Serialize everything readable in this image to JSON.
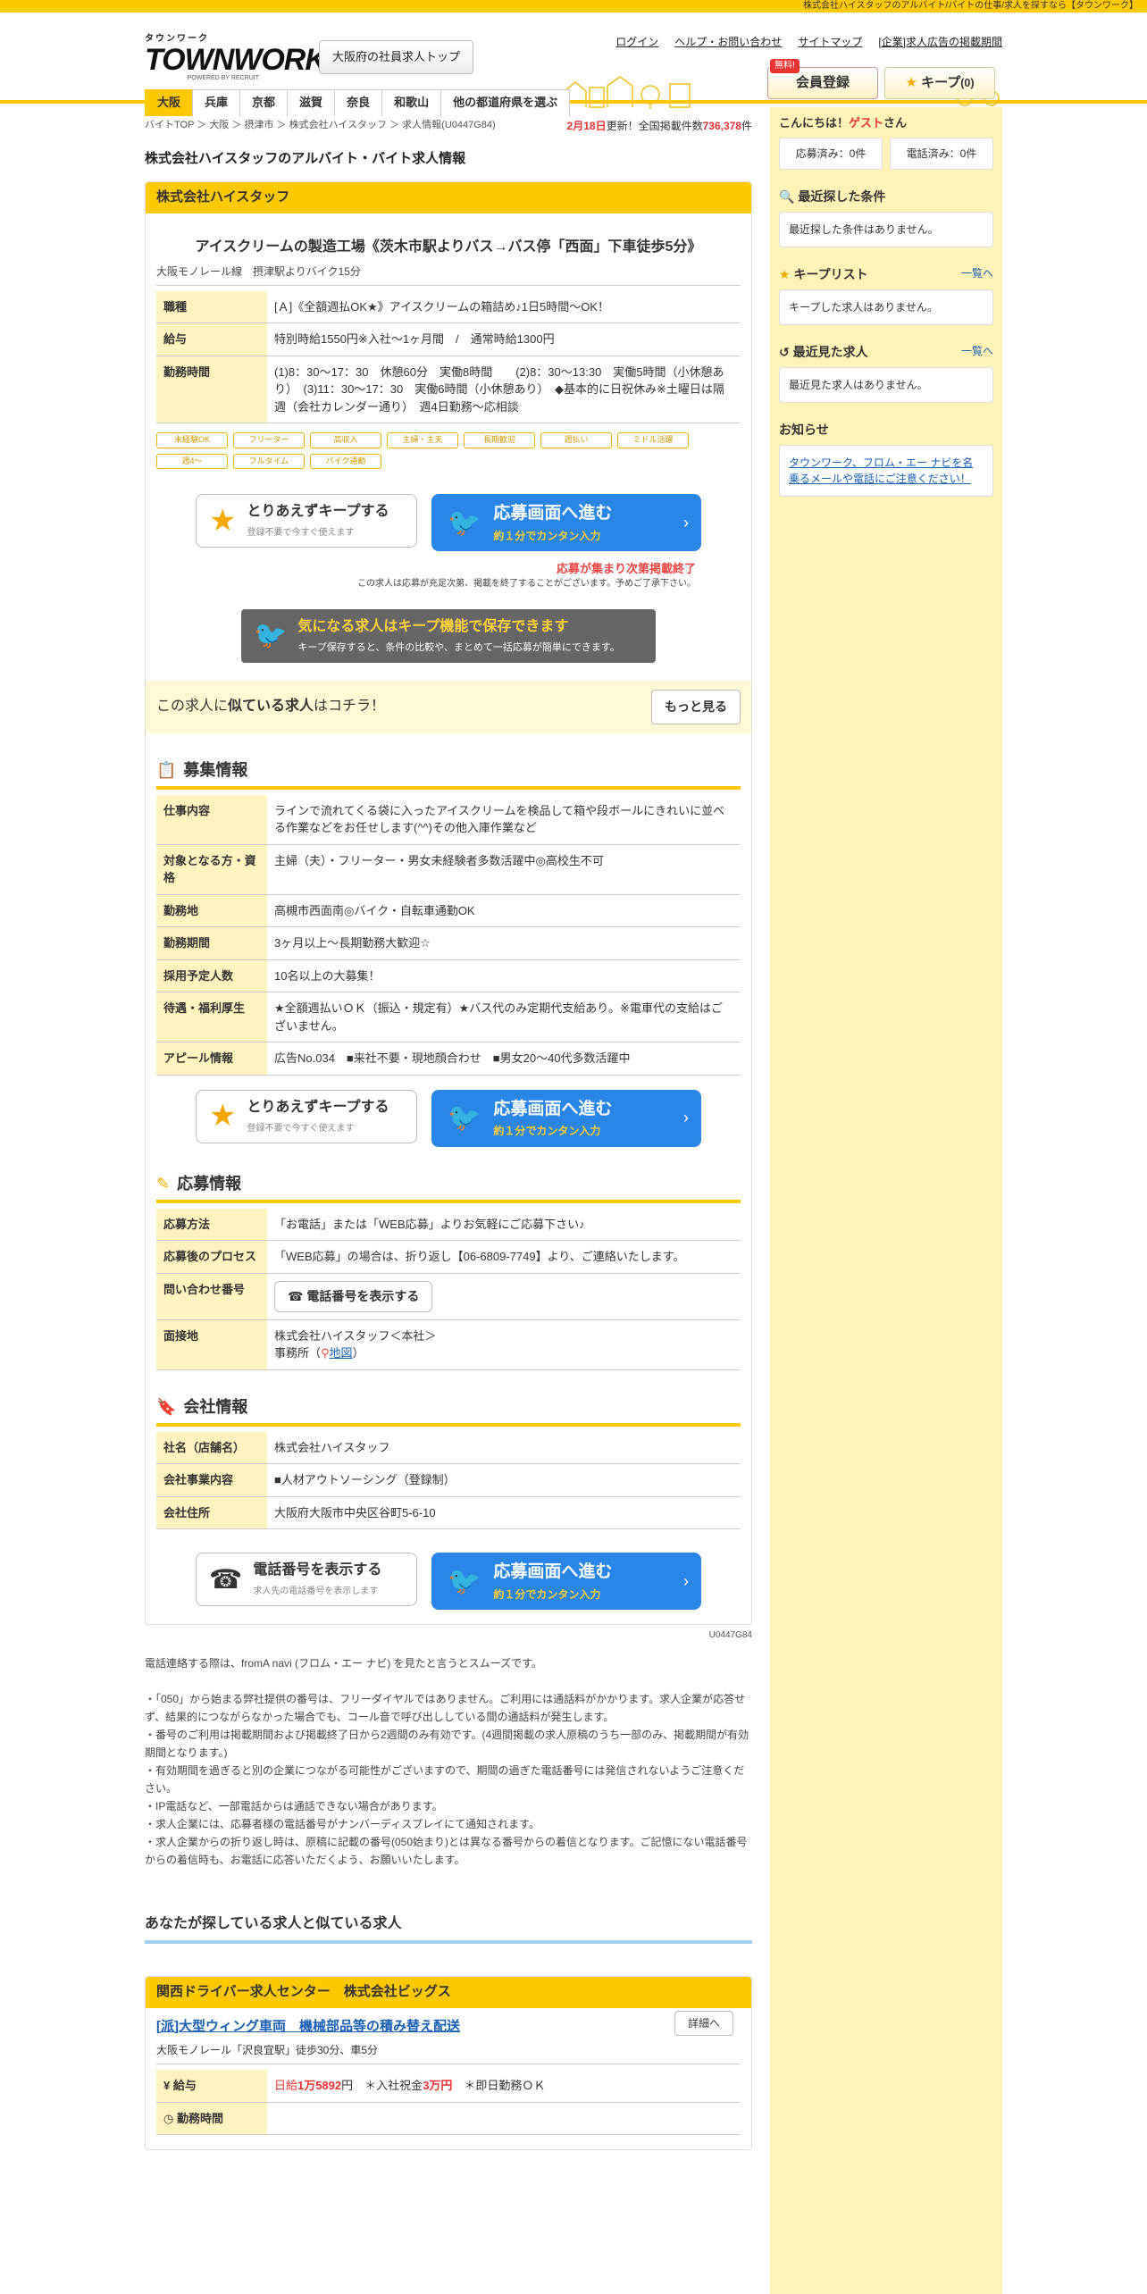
{
  "topbar": "株式会社ハイスタッフのアルバイト/バイトの仕事/求人を探すなら【タウンワーク】",
  "logo": {
    "kana": "タウンワーク",
    "name": "TOWNWORK",
    "by": "POWERED BY RECRUIT"
  },
  "top_button": "大阪府の社員求人トップ",
  "header_links": [
    "ログイン",
    "ヘルプ・お問い合わせ",
    "サイトマップ",
    "[企業]求人広告の掲載期間"
  ],
  "register": {
    "free": "無料!",
    "label": "会員登録"
  },
  "keep": {
    "label": "キープ",
    "count": "(0)"
  },
  "prefs": [
    "大阪",
    "兵庫",
    "京都",
    "滋賀",
    "奈良",
    "和歌山",
    "他の都道府県を選ぶ"
  ],
  "breadcrumb": [
    "バイトTOP",
    "大阪",
    "摂津市",
    "株式会社ハイスタッフ",
    "求人情報(U0447G84)"
  ],
  "count": {
    "date": "2月18日",
    "mid": "更新！全国掲載件数",
    "num": "736,378",
    "unit": "件"
  },
  "page_title": "株式会社ハイスタッフのアルバイト・バイト求人情報",
  "company": "株式会社ハイスタッフ",
  "job_title": "アイスクリームの製造工場《茨木市駅よりバス→バス停「西面」下車徒歩5分》",
  "station": "大阪モノレール線　摂津駅よりバイク15分",
  "summary": [
    {
      "k": "職種",
      "v": "[Ａ]《全額週払OK★》アイスクリームの箱詰め♪1日5時間～OK！"
    },
    {
      "k": "給与",
      "v": "特別時給1550円※入社～1ヶ月間　/　通常時給1300円"
    },
    {
      "k": "勤務時間",
      "v": "(1)8：30～17：30　休憩60分　実働8時間　　(2)8：30～13:30　実働5時間（小休憩あり）　(3)11：30～17：30　実働6時間（小休憩あり）　◆基本的に日祝休み※土曜日は隔週（会社カレンダー通り）　週4日勤務～応相談"
    }
  ],
  "tags": [
    "未経験OK",
    "フリーター",
    "高収入",
    "主婦・主夫",
    "長期歓迎",
    "週払い",
    "ミドル活躍",
    "週4～",
    "フルタイム",
    "バイク通勤"
  ],
  "cta": {
    "keep": "とりあえずキープする",
    "keep_sub": "登録不要で今すぐ使えます",
    "apply": "応募画面へ進む",
    "apply_sub": "約１分でカンタン入力",
    "tel": "電話番号を表示する",
    "tel_sub": "求人先の電話番号を表示します"
  },
  "ending": "応募が集まり次第掲載終了",
  "ending_note": "この求人は応募が充足次第、掲載を終了することがございます。予めご了承下さい。",
  "banner": {
    "t": "気になる求人はキープ機能で保存できます",
    "s": "キープ保存すると、条件の比較や、まとめて一括応募が簡単にできます。"
  },
  "similar": {
    "a": "この求人に",
    "b": "似ている求人",
    "c": "はコチラ！",
    "more": "もっと見る"
  },
  "sec1": "募集情報",
  "recruit": [
    {
      "k": "仕事内容",
      "v": "ラインで流れてくる袋に入ったアイスクリームを検品して箱や段ボールにきれいに並べる作業などをお任せします(^^)その他入庫作業など"
    },
    {
      "k": "対象となる方・資格",
      "v": "主婦（夫）・フリーター・男女未経験者多数活躍中◎高校生不可"
    },
    {
      "k": "勤務地",
      "v": "高槻市西面南◎バイク・自転車通勤OK"
    },
    {
      "k": "勤務期間",
      "v": "3ヶ月以上～長期勤務大歓迎☆"
    },
    {
      "k": "採用予定人数",
      "v": "10名以上の大募集！"
    },
    {
      "k": "待遇・福利厚生",
      "v": "★全額週払いＯＫ（振込・規定有）★バス代のみ定期代支給あり。※電車代の支給はございません。"
    },
    {
      "k": "アピール情報",
      "v": "広告No.034　■来社不要・現地顔合わせ　■男女20～40代多数活躍中"
    }
  ],
  "sec2": "応募情報",
  "apply": [
    {
      "k": "応募方法",
      "v": "「お電話」または「WEB応募」よりお気軽にご応募下さい♪"
    },
    {
      "k": "応募後のプロセス",
      "v": "「WEB応募」の場合は、折り返し【06-6809-7749】より、ご連絡いたします。"
    },
    {
      "k": "問い合わせ番号",
      "v": "電話番号を表示する"
    },
    {
      "k": "面接地",
      "v": "株式会社ハイスタッフ＜本社＞",
      "v2": "事務所（",
      "map": "地図",
      "v3": "）"
    }
  ],
  "sec3": "会社情報",
  "companyinfo": [
    {
      "k": "社名（店舗名）",
      "v": "株式会社ハイスタッフ"
    },
    {
      "k": "会社事業内容",
      "v": "■人材アウトソーシング（登録制）"
    },
    {
      "k": "会社住所",
      "v": "大阪府大阪市中央区谷町5-6-10"
    }
  ],
  "uid": "U0447G84",
  "notes": [
    "電話連絡する際は、fromA navi (フロム・エー ナビ) を見たと言うとスムーズです。",
    "",
    "・「050」から始まる弊社提供の番号は、フリーダイヤルではありません。ご利用には通話料がかかります。求人企業が応答せず、結果的につながらなかった場合でも、コール音で呼び出ししている間の通話料が発生します。",
    "・番号のご利用は掲載期間および掲載終了日から2週間のみ有効です。(4週間掲載の求人原稿のうち一部のみ、掲載期間が有効期間となります。)",
    "・有効期間を過ぎると別の企業につながる可能性がございますので、期間の過ぎた電話番号には発信されないようご注意ください。",
    "・IP電話など、一部電話からは通話できない場合があります。",
    "・求人企業には、応募者様の電話番号がナンバーディスプレイにて通知されます。",
    "・求人企業からの折り返し時は、原稿に記載の番号(050始まり)とは異なる番号からの着信となります。ご記憶にない電話番号からの着信時も、お電話に応答いただくよう、お願いいたします。"
  ],
  "similar_h": "あなたが探している求人と似ている求人",
  "rcard": {
    "company": "関西ドライバー求人センター　株式会社ビッグス",
    "title": "[派]大型ウィング車両　機械部品等の積み替え配送",
    "station": "大阪モノレール「沢良宜駅」徒歩30分、車5分",
    "detail": "詳細へ",
    "salary_k": "給与",
    "salary_a": "日給",
    "salary_b": "1万5892",
    "salary_c": "円　＊入社祝金",
    "salary_d": "3万円",
    "salary_e": "　＊即日勤務ＯＫ",
    "time_k": "勤務時間"
  },
  "side": {
    "greet_a": "こんにちは！",
    "greet_b": "ゲスト",
    "greet_c": "さん",
    "applied": "応募済み：0件",
    "called": "電話済み：0件",
    "recent_h": "最近探した条件",
    "recent_b": "最近探した条件はありません。",
    "keep_h": "キープリスト",
    "keep_link": "一覧へ",
    "keep_b": "キープした求人はありません。",
    "seen_h": "最近見た求人",
    "seen_link": "一覧へ",
    "seen_b": "最近見た求人はありません。",
    "info_h": "お知らせ",
    "info_b": "タウンワーク、フロム・エー ナビを名乗るメールや電話にご注意ください！"
  }
}
